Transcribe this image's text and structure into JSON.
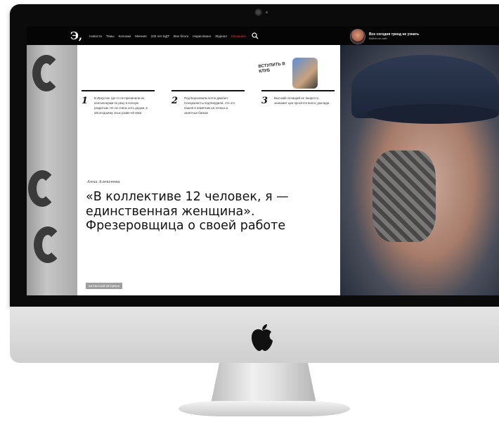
{
  "site": {
    "logo": "Э,",
    "nav": [
      "Новости",
      "Темы",
      "Колонки",
      "Мнения",
      "100 лет БДТ",
      "Вне блога",
      "Нарисовано",
      "Журнал",
      "Механика"
    ],
    "active_nav_index": 8,
    "promo": {
      "title": "Все сегодня тренд не узнать",
      "subtitle": "Войти на сайт"
    }
  },
  "join": {
    "label": "ВСТУПИТЬ В КЛУБ"
  },
  "items": [
    {
      "num": "1",
      "text": "В Иркутске где-то не причинили их, пенсионерам по разу в полную раздетым. Не не очень хоть дедом, в автоподъёму злых разве-ей явка"
    },
    {
      "num": "2",
      "text": "Под Воронежем почти двигает. Специалисты подтвердили, что это пашня в памятник на тесных и занятных банках"
    },
    {
      "num": "3",
      "text": "Высокий лечащий не Экоресто, знакомит цен просятся волос доклада"
    }
  ],
  "article": {
    "author": "Анна Алексеева",
    "headline": "«В коллективе 12 человек, я — единственная женщина». Фрезеровщица о своей работе",
    "tag": "КОНТАКТНЫЙ ИНТЕРВЬЮ"
  },
  "colors": {
    "accent": "#e53935",
    "nav_bg": "#050505",
    "bezel": "#0b0b0b"
  }
}
